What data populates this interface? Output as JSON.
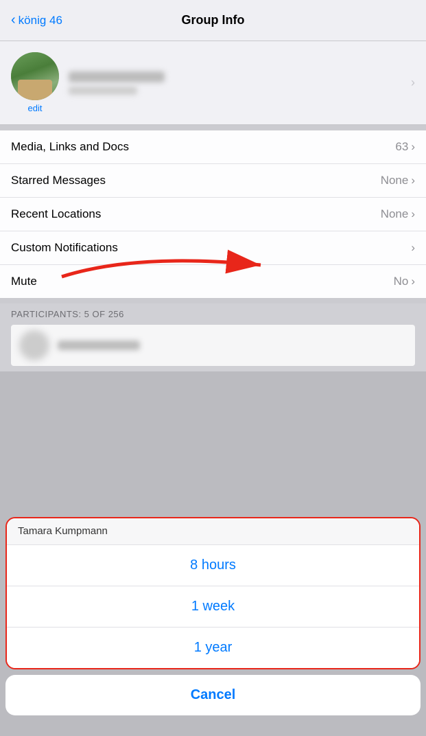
{
  "nav": {
    "back_label": "könig 46",
    "title": "Group Info"
  },
  "profile": {
    "edit_label": "edit"
  },
  "menu": {
    "items": [
      {
        "label": "Media, Links and Docs",
        "value": "63",
        "show_chevron": true
      },
      {
        "label": "Starred Messages",
        "value": "None",
        "show_chevron": true
      },
      {
        "label": "Recent Locations",
        "value": "None",
        "show_chevron": true
      },
      {
        "label": "Custom Notifications",
        "value": "",
        "show_chevron": true
      },
      {
        "label": "Mute",
        "value": "No",
        "show_chevron": true
      }
    ]
  },
  "participants": {
    "label": "PARTICIPANTS: 5 OF 256"
  },
  "participant_name": "Tamara Kumpmann",
  "action_sheet": {
    "options": [
      {
        "label": "8 hours"
      },
      {
        "label": "1 week"
      },
      {
        "label": "1 year"
      }
    ],
    "cancel_label": "Cancel"
  }
}
